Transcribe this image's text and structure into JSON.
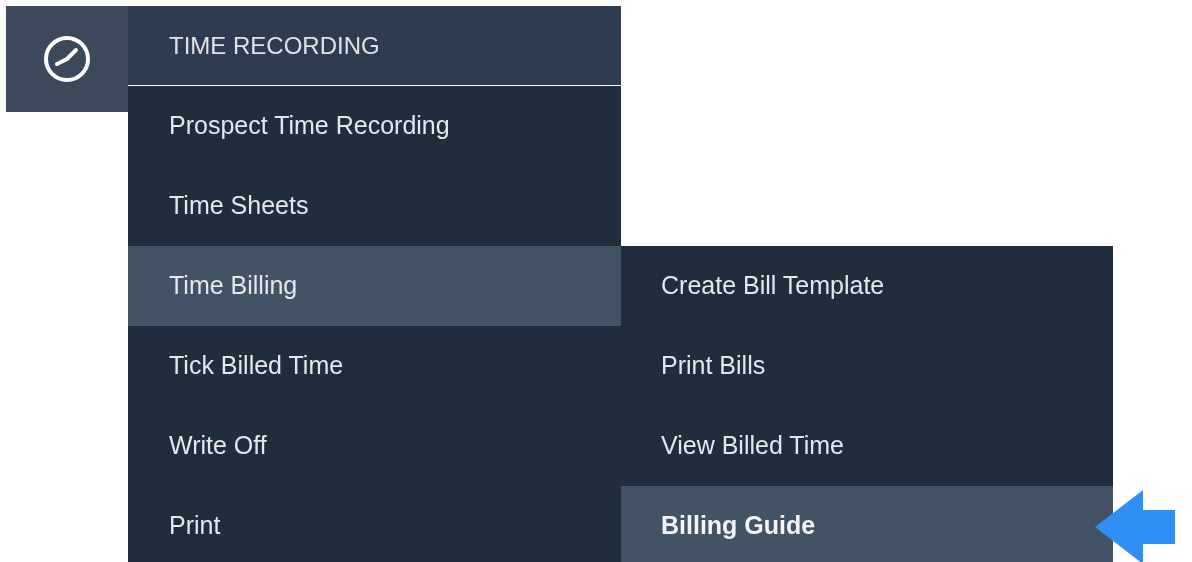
{
  "header": {
    "title": "TIME RECORDING"
  },
  "menu": [
    {
      "label": "Prospect Time Recording",
      "selected": false
    },
    {
      "label": "Time Sheets",
      "selected": false
    },
    {
      "label": "Time Billing",
      "selected": true
    },
    {
      "label": "Tick Billed Time",
      "selected": false
    },
    {
      "label": "Write Off",
      "selected": false
    },
    {
      "label": "Print",
      "selected": false
    }
  ],
  "submenu": [
    {
      "label": "Create Bill Template",
      "selected": false
    },
    {
      "label": "Print Bills",
      "selected": false
    },
    {
      "label": "View Billed Time",
      "selected": false
    },
    {
      "label": "Billing Guide",
      "selected": true
    }
  ]
}
